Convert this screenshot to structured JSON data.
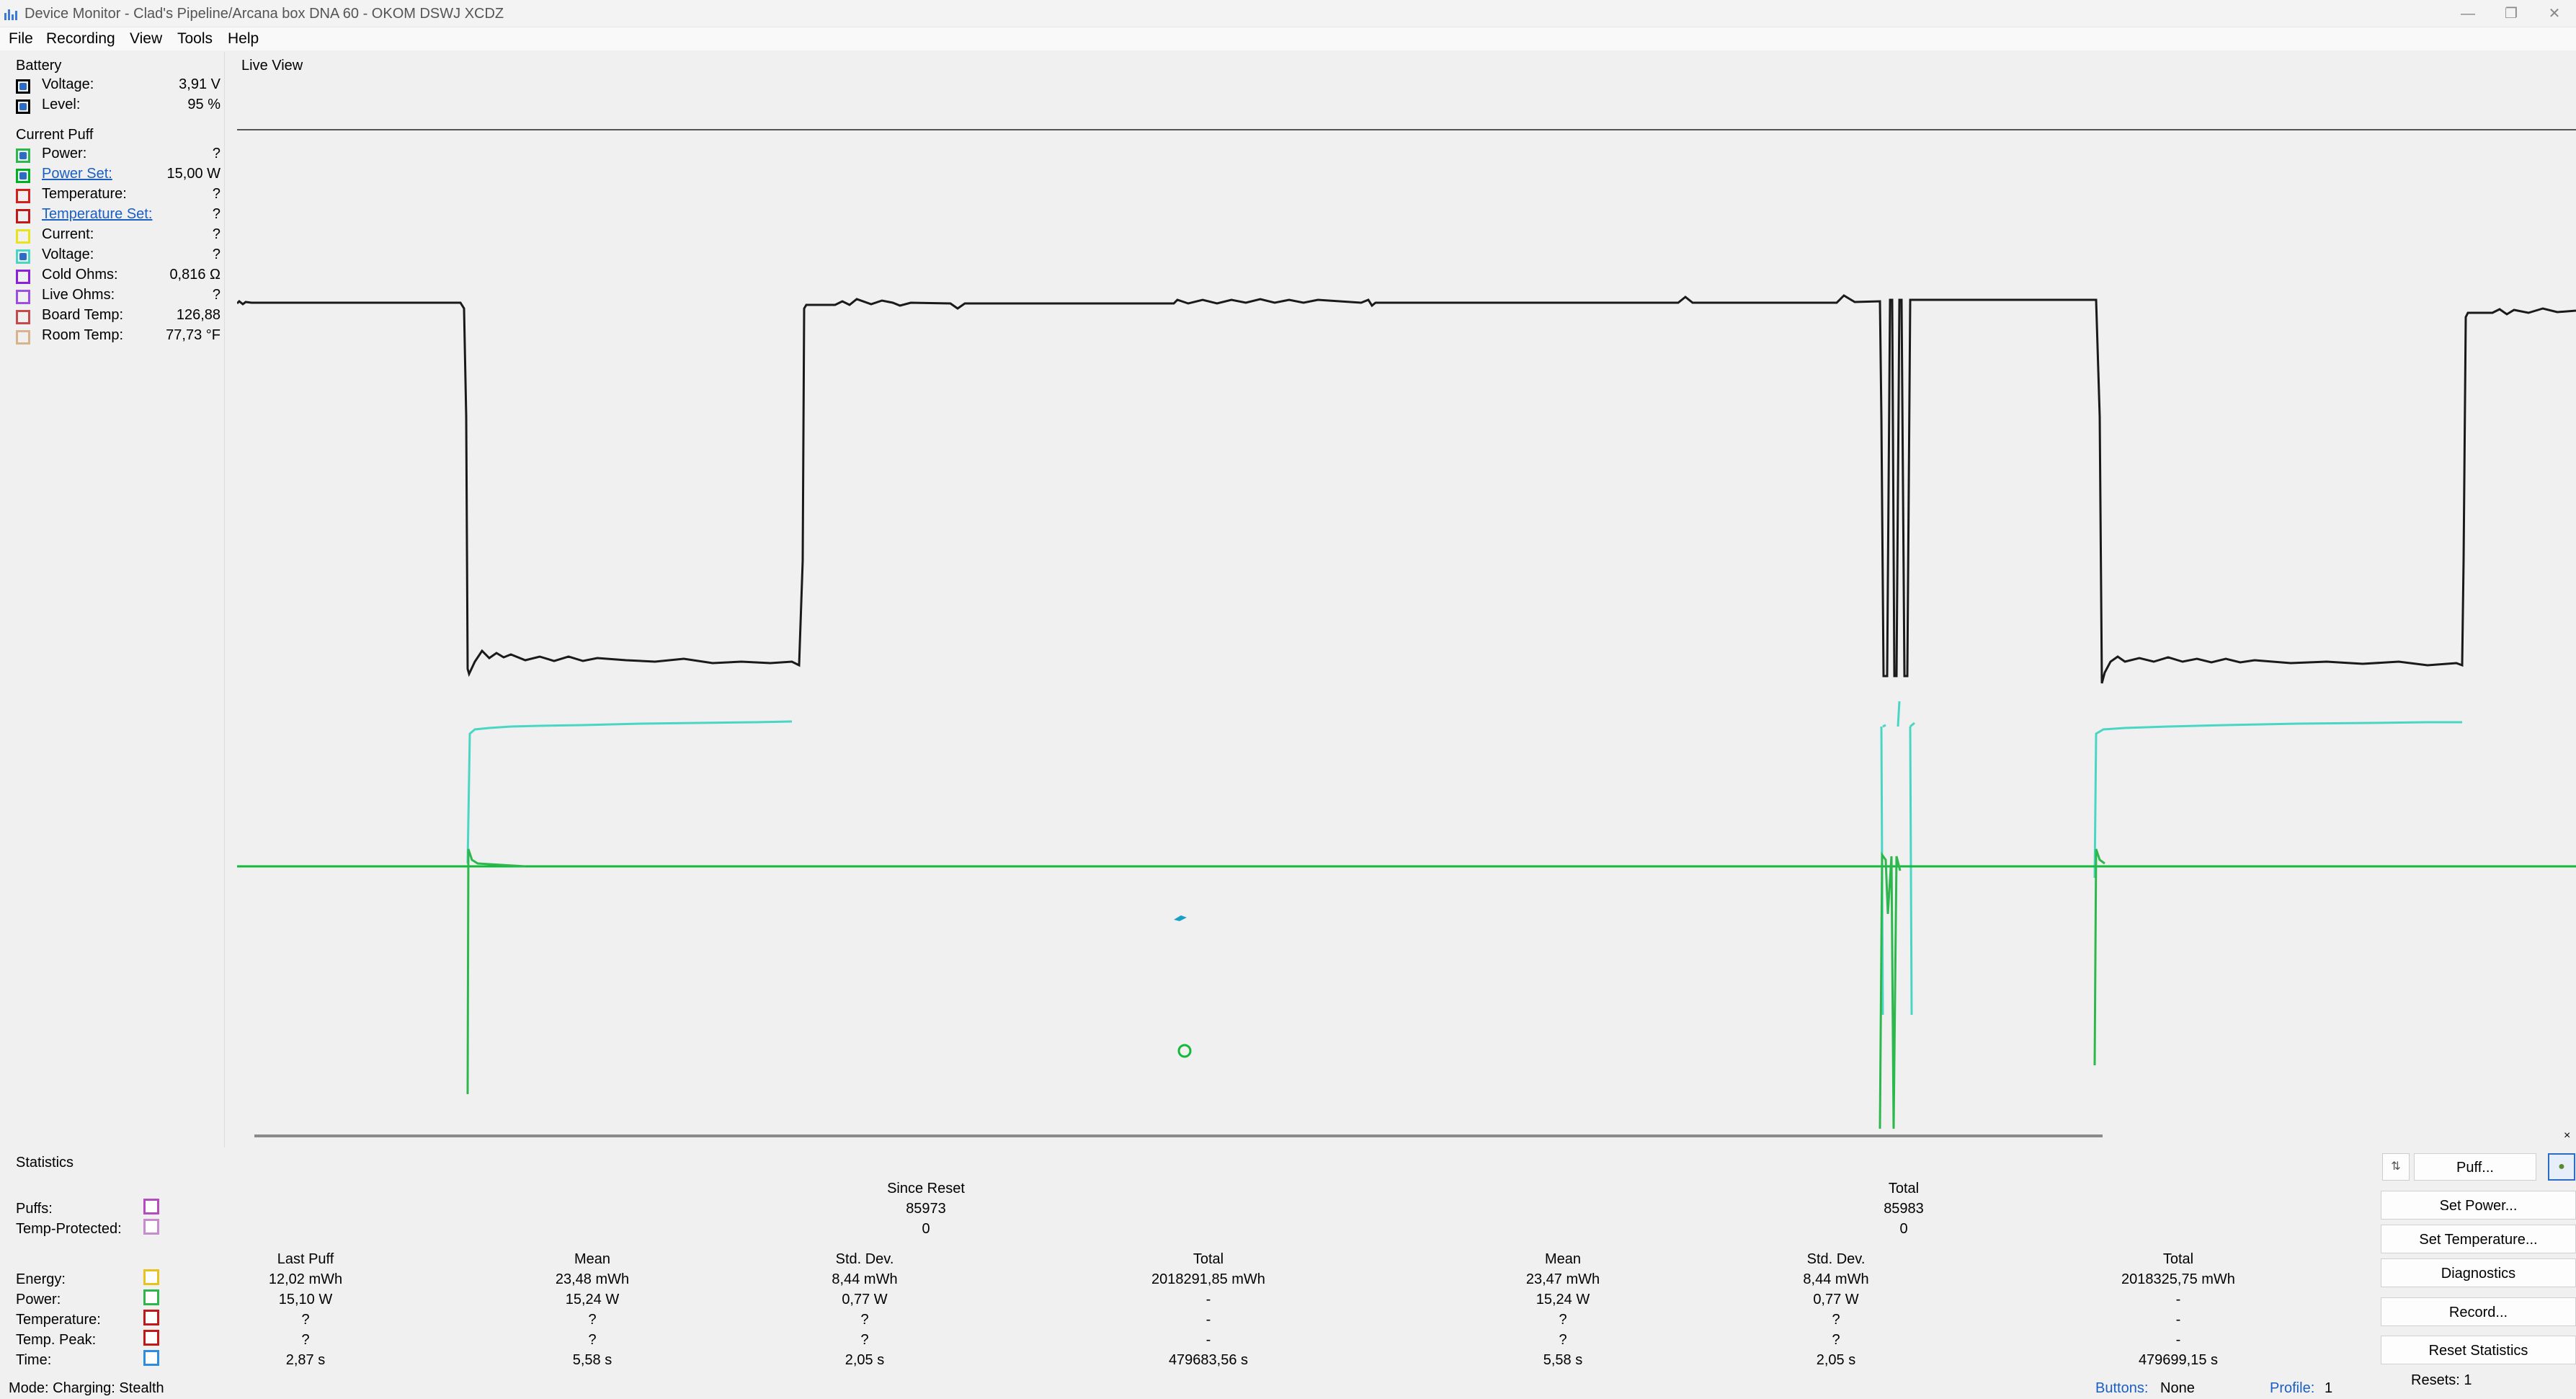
{
  "window": {
    "title": "Device Monitor - Clad's Pipeline/Arcana box DNA 60 - OKOM DSWJ XCDZ"
  },
  "menu": [
    "File",
    "Recording",
    "View",
    "Tools",
    "Help"
  ],
  "battery": {
    "header": "Battery",
    "rows": [
      {
        "label": "Voltage:",
        "value": "3,91 V",
        "color": "#000000",
        "checked": true
      },
      {
        "label": "Level:",
        "value": "95 %",
        "color": "#000000",
        "checked": true
      }
    ]
  },
  "current_puff": {
    "header": "Current Puff",
    "rows": [
      {
        "label": "Power:",
        "value": "?",
        "color": "#2db84d",
        "checked": true,
        "link": false
      },
      {
        "label": "Power Set:",
        "value": "15,00 W",
        "color": "#00b020",
        "checked": true,
        "link": true
      },
      {
        "label": "Temperature:",
        "value": "?",
        "color": "#d21f1f",
        "checked": false,
        "link": false
      },
      {
        "label": "Temperature Set:",
        "value": "?",
        "color": "#c21818",
        "checked": false,
        "link": true
      },
      {
        "label": "Current:",
        "value": "?",
        "color": "#e8e31e",
        "checked": false,
        "link": false
      },
      {
        "label": "Voltage:",
        "value": "?",
        "color": "#4ad6c4",
        "checked": true,
        "link": false
      },
      {
        "label": "Cold Ohms:",
        "value": "0,816 Ω",
        "color": "#8a21d6",
        "checked": false,
        "link": false
      },
      {
        "label": "Live Ohms:",
        "value": "?",
        "color": "#9b4ee0",
        "checked": false,
        "link": false
      },
      {
        "label": "Board Temp:",
        "value": "126,88",
        "color": "#c44b4b",
        "checked": false,
        "link": false
      },
      {
        "label": "Room Temp:",
        "value": "77,73 °F",
        "color": "#d9b38c",
        "checked": false,
        "link": false
      }
    ]
  },
  "live_view": {
    "label": "Live View",
    "colors": {
      "battery": "#000000",
      "voltage": "#4ad6c4",
      "power": "#2db84d"
    }
  },
  "statistics": {
    "header": "Statistics",
    "since_reset_label": "Since Reset",
    "total_label": "Total",
    "puffs_label": "Puffs:",
    "temp_protected_label": "Temp-Protected:",
    "puffs_since_reset": "85973",
    "temp_protected_since_reset": "0",
    "puffs_total": "85983",
    "temp_protected_total": "0",
    "columns": [
      "Last Puff",
      "Mean",
      "Std. Dev.",
      "Total",
      "Mean",
      "Std. Dev.",
      "Total"
    ],
    "rows": [
      {
        "label": "Energy:",
        "color": "#e8c31e",
        "values": [
          "12,02 mWh",
          "23,48 mWh",
          "8,44 mWh",
          "2018291,85 mWh",
          "23,47 mWh",
          "8,44 mWh",
          "2018325,75 mWh"
        ]
      },
      {
        "label": "Power:",
        "color": "#2db84d",
        "values": [
          "15,10 W",
          "15,24 W",
          "0,77 W",
          "-",
          "15,24 W",
          "0,77 W",
          "-"
        ]
      },
      {
        "label": "Temperature:",
        "color": "#c21818",
        "values": [
          "?",
          "?",
          "?",
          "-",
          "?",
          "?",
          "-"
        ]
      },
      {
        "label": "Temp. Peak:",
        "color": "#c21818",
        "values": [
          "?",
          "?",
          "?",
          "-",
          "?",
          "?",
          "-"
        ]
      },
      {
        "label": "Time:",
        "color": "#2d8be0",
        "values": [
          "2,87 s",
          "5,58 s",
          "2,05 s",
          "479683,56 s",
          "5,58 s",
          "2,05 s",
          "479699,15 s"
        ]
      }
    ]
  },
  "buttons": {
    "puff": "Puff...",
    "set_power": "Set Power...",
    "set_temperature": "Set Temperature...",
    "diagnostics": "Diagnostics",
    "record": "Record...",
    "reset_statistics": "Reset Statistics"
  },
  "status": {
    "mode": "Mode: Charging: Stealth",
    "buttons_label": "Buttons:",
    "buttons_value": "None",
    "profile_label": "Profile:",
    "profile_value": "1",
    "resets": "Resets: 1"
  }
}
